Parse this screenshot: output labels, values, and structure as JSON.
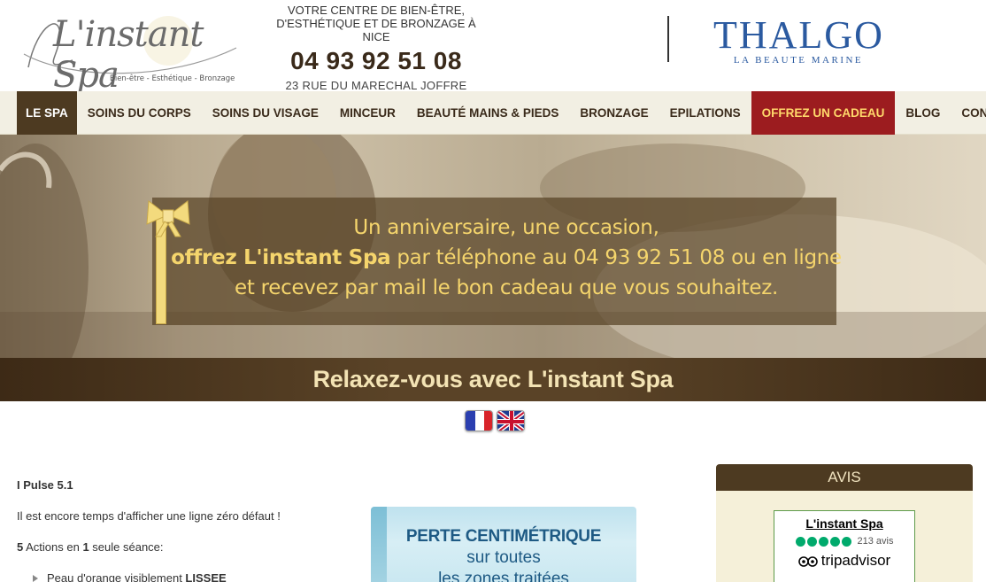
{
  "header": {
    "logo": {
      "script": "L'instant Spa",
      "tagline": "Bien-être - Esthétique - Bronzage"
    },
    "info": {
      "line1": "VOTRE CENTRE DE BIEN-ÊTRE,",
      "line2": "D'ESTHÉTIQUE ET DE BRONZAGE À NICE",
      "phone": "04 93 92 51 08",
      "address": "23 RUE DU MARECHAL JOFFRE"
    },
    "partner": {
      "name": "THALGO",
      "subtitle": "LA BEAUTE MARINE"
    }
  },
  "nav": {
    "items": [
      {
        "label": "LE SPA",
        "state": "active"
      },
      {
        "label": "SOINS DU CORPS"
      },
      {
        "label": "SOINS DU VISAGE"
      },
      {
        "label": "MINCEUR"
      },
      {
        "label": "BEAUTÉ MAINS & PIEDS"
      },
      {
        "label": "BRONZAGE"
      },
      {
        "label": "EPILATIONS"
      },
      {
        "label": "OFFREZ UN CADEAU",
        "state": "highlight"
      },
      {
        "label": "BLOG"
      },
      {
        "label": "CONTACT"
      }
    ]
  },
  "hero": {
    "line1": "Un anniversaire, une occasion,",
    "line2_strong": "offrez L'instant Spa",
    "line2_rest": " par téléphone au 04 93 92 51 08 ou en ligne",
    "line3": "et recevez par mail le bon cadeau que vous souhaitez.",
    "banner": "Relaxez-vous avec L'instant Spa"
  },
  "languages": [
    {
      "name": "french-flag-icon"
    },
    {
      "name": "uk-flag-icon"
    }
  ],
  "content": {
    "title": "I Pulse 5.1",
    "p1": "Il est encore temps d'afficher une ligne zéro défaut !",
    "p2_num1": "5",
    "p2_mid": " Actions en ",
    "p2_num2": "1",
    "p2_end": " seule séance:",
    "list": [
      {
        "prefix": "Peau d'orange visiblement ",
        "strong": "LISSEE"
      }
    ],
    "promo_image": {
      "line1": "PERTE CENTIMÉTRIQUE",
      "line2": "sur toutes",
      "line3": "les zones traitées"
    }
  },
  "reviews": {
    "header": "AVIS",
    "business": "L'instant Spa",
    "rating": 5,
    "count": "213 avis",
    "provider": "tripadvisor"
  },
  "colors": {
    "brown": "#4d3a21",
    "gift_red": "#9c1c1f",
    "gold": "#f5d56c",
    "thalgo_blue": "#2b5aa0",
    "ta_green": "#00aa6c"
  }
}
